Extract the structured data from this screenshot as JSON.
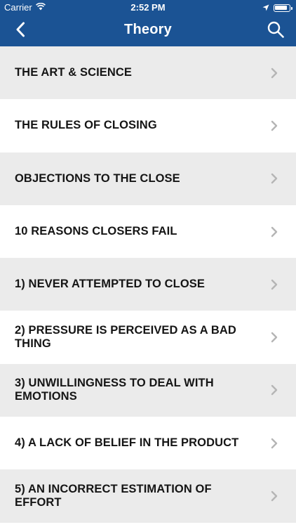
{
  "status_bar": {
    "carrier": "Carrier",
    "time": "2:52 PM"
  },
  "navbar": {
    "title": "Theory",
    "back_icon": "chevron-left-icon",
    "search_icon": "search-icon"
  },
  "colors": {
    "header": "#1b5394",
    "row_shaded": "#ebebeb",
    "row_plain": "#ffffff",
    "chevron": "#b5b5b5"
  },
  "list": {
    "items": [
      {
        "label": "THE ART & SCIENCE"
      },
      {
        "label": "THE RULES OF CLOSING"
      },
      {
        "label": "OBJECTIONS TO THE CLOSE"
      },
      {
        "label": "10 REASONS CLOSERS FAIL"
      },
      {
        "label": "1) NEVER ATTEMPTED TO CLOSE"
      },
      {
        "label": "2) PRESSURE IS PERCEIVED AS A BAD THING"
      },
      {
        "label": "3) UNWILLINGNESS TO DEAL WITH EMOTIONS"
      },
      {
        "label": "4) A LACK OF BELIEF IN THE PRODUCT"
      },
      {
        "label": "5) AN INCORRECT ESTIMATION OF EFFORT"
      }
    ]
  }
}
